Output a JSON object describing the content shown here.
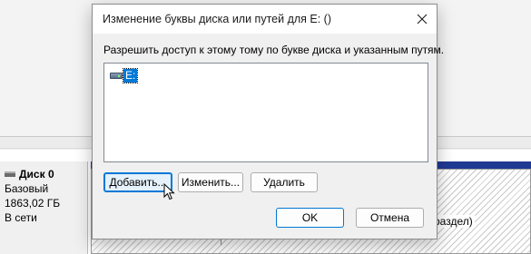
{
  "background": {
    "disk": {
      "name": "Диск 0",
      "type": "Базовый",
      "size": "1863,02 ГБ",
      "status": "В сети"
    },
    "partition_label_fragment": "раздел)",
    "partition_bar_color": "#1f3a93"
  },
  "dialog": {
    "title": "Изменение буквы диска или путей для E: ()",
    "prompt": "Разрешить доступ к этому тому по букве диска и указанным путям.",
    "list": {
      "items": [
        {
          "label": "E:",
          "icon": "drive-icon",
          "selected": true
        }
      ]
    },
    "buttons": {
      "add": "Добавить...",
      "change": "Изменить...",
      "delete": "Удалить",
      "ok": "OK",
      "cancel": "Отмена"
    },
    "close_icon": "close-icon",
    "accent": "#0078d7"
  }
}
